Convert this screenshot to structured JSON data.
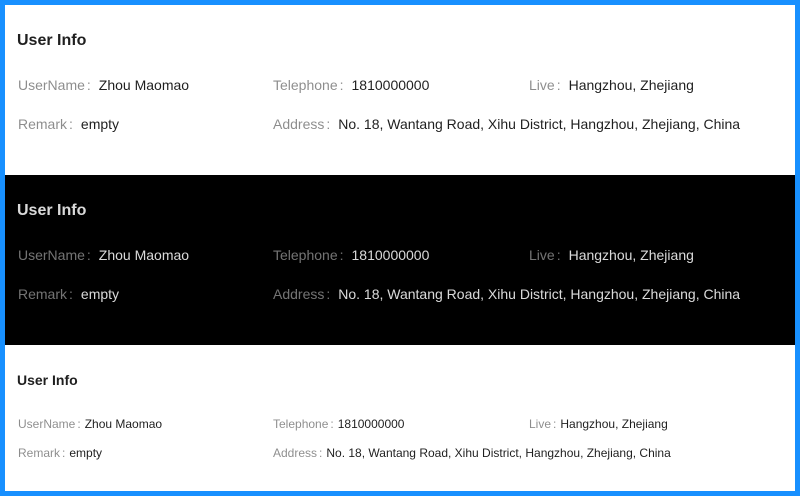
{
  "panels": [
    {
      "title": "User Info",
      "fields": {
        "username": {
          "label": "UserName",
          "value": "Zhou Maomao"
        },
        "telephone": {
          "label": "Telephone",
          "value": "1810000000"
        },
        "live": {
          "label": "Live",
          "value": "Hangzhou, Zhejiang"
        },
        "remark": {
          "label": "Remark",
          "value": "empty"
        },
        "address": {
          "label": "Address",
          "value": "No. 18, Wantang Road, Xihu District, Hangzhou, Zhejiang, China"
        }
      }
    },
    {
      "title": "User Info",
      "fields": {
        "username": {
          "label": "UserName",
          "value": "Zhou Maomao"
        },
        "telephone": {
          "label": "Telephone",
          "value": "1810000000"
        },
        "live": {
          "label": "Live",
          "value": "Hangzhou, Zhejiang"
        },
        "remark": {
          "label": "Remark",
          "value": "empty"
        },
        "address": {
          "label": "Address",
          "value": "No. 18, Wantang Road, Xihu District, Hangzhou, Zhejiang, China"
        }
      }
    },
    {
      "title": "User Info",
      "fields": {
        "username": {
          "label": "UserName",
          "value": "Zhou Maomao"
        },
        "telephone": {
          "label": "Telephone",
          "value": "1810000000"
        },
        "live": {
          "label": "Live",
          "value": "Hangzhou, Zhejiang"
        },
        "remark": {
          "label": "Remark",
          "value": "empty"
        },
        "address": {
          "label": "Address",
          "value": "No. 18, Wantang Road, Xihu District, Hangzhou, Zhejiang, China"
        }
      }
    }
  ],
  "separator": ":",
  "colors": {
    "frame_border": "#1890ff",
    "light_bg": "#ffffff",
    "dark_bg": "#000000"
  }
}
